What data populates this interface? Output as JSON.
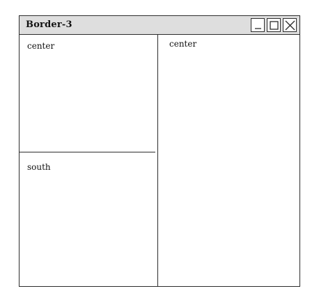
{
  "window": {
    "title": "Border-3",
    "controls": {
      "minimize_icon": "minimize-icon",
      "maximize_icon": "maximize-icon",
      "close_icon": "close-icon"
    }
  },
  "layout_regions": {
    "left_center_label": "center",
    "south_label": "south",
    "right_center_label": "center"
  },
  "colors": {
    "titlebar_bg": "#dedede",
    "border": "#2c2c2c",
    "background": "#ffffff"
  }
}
